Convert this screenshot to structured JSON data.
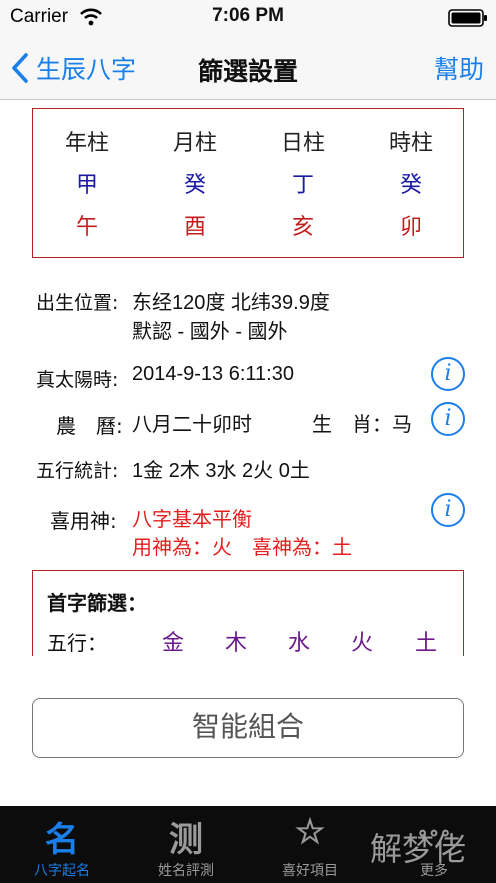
{
  "status_bar": {
    "carrier": "Carrier",
    "time": "7:06 PM"
  },
  "nav": {
    "back_label": "生辰八字",
    "title": "篩選設置",
    "help_label": "幫助"
  },
  "bazi": {
    "headers": [
      "年柱",
      "月柱",
      "日柱",
      "時柱"
    ],
    "stems": [
      "甲",
      "癸",
      "丁",
      "癸"
    ],
    "branches": [
      "午",
      "酉",
      "亥",
      "卯"
    ]
  },
  "info": {
    "birthplace_label": "出生位置:",
    "birthplace_line1": "东经120度 北纬39.9度",
    "birthplace_line2": "默認 - 國外 - 國外",
    "solar_time_label": "真太陽時:",
    "solar_time_value": "2014-9-13 6:11:30",
    "lunar_label": "農　曆:",
    "lunar_value": "八月二十卯时",
    "zodiac_label": "生　肖：马",
    "wuxing_label": "五行統計:",
    "wuxing_value": "1金 2木 3水 2火 0土",
    "xiyong_label": "喜用神:",
    "xiyong_line1": "八字基本平衡",
    "xiyong_line2": "用神為：火　喜神為：土",
    "info_glyph": "i"
  },
  "filter": {
    "title": "首字篩選：",
    "label": "五行：",
    "elements": [
      "金",
      "木",
      "水",
      "火",
      "土"
    ]
  },
  "combine_button": "智能組合",
  "tabs": [
    {
      "glyph": "名",
      "label": "八字起名",
      "active": true
    },
    {
      "glyph": "测",
      "label": "姓名評測",
      "active": false
    },
    {
      "glyph": "☆",
      "label": "喜好項目",
      "active": false
    },
    {
      "glyph": "∘∘∘",
      "label": "更多",
      "active": false
    }
  ],
  "watermark": "解梦佬",
  "colors": {
    "accent": "#1a7fe8",
    "frame_red": "#b22222",
    "stem_blue": "#1a1aa6",
    "branch_red": "#c41d1d",
    "highlight_red": "#e61e1e",
    "element_purple": "#6a1a8a",
    "tab_bar_bg": "#0c0c0c"
  }
}
